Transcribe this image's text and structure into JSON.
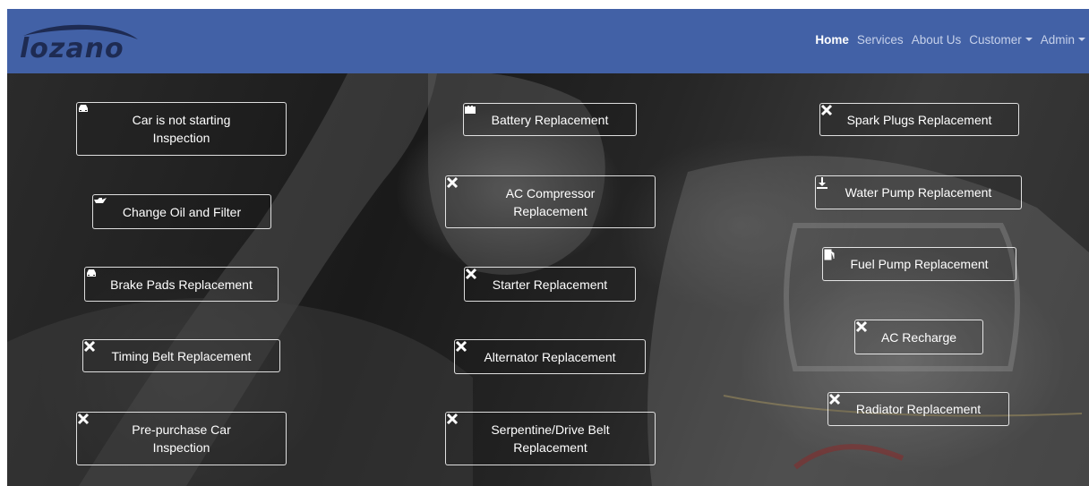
{
  "brand": {
    "logo_text": "lozano"
  },
  "nav": {
    "home": "Home",
    "services": "Services",
    "about": "About Us",
    "customer": "Customer",
    "admin": "Admin"
  },
  "services": {
    "car_not_starting_l1": "Car is not starting",
    "car_not_starting_l2": "Inspection",
    "battery": "Battery Replacement",
    "spark_plugs": "Spark Plugs Replacement",
    "oil_filter": "Change Oil and Filter",
    "ac_compressor_l1": "AC Compressor",
    "ac_compressor_l2": "Replacement",
    "water_pump": "Water Pump Replacement",
    "fuel_pump": "Fuel Pump Replacement",
    "brake_pads": "Brake Pads Replacement",
    "starter": "Starter Replacement",
    "ac_recharge": "AC Recharge",
    "timing_belt": "Timing Belt Replacement",
    "alternator": "Alternator Replacement",
    "radiator": "Radiator Replacement",
    "pre_purchase_l1": "Pre-purchase Car",
    "pre_purchase_l2": "Inspection",
    "serpentine_l1": "Serpentine/Drive Belt",
    "serpentine_l2": "Replacement"
  },
  "icons": {
    "car": "car-icon",
    "battery": "battery-icon",
    "tools": "tools-icon",
    "oil": "oil-can-icon",
    "water": "water-pump-icon",
    "fuel": "fuel-pump-icon"
  },
  "colors": {
    "navbar": "#4261a6",
    "logo": "#1e2b52",
    "nav_active": "#ffffff",
    "nav_link": "#c6d1ea",
    "button_border": "#ffffff"
  }
}
